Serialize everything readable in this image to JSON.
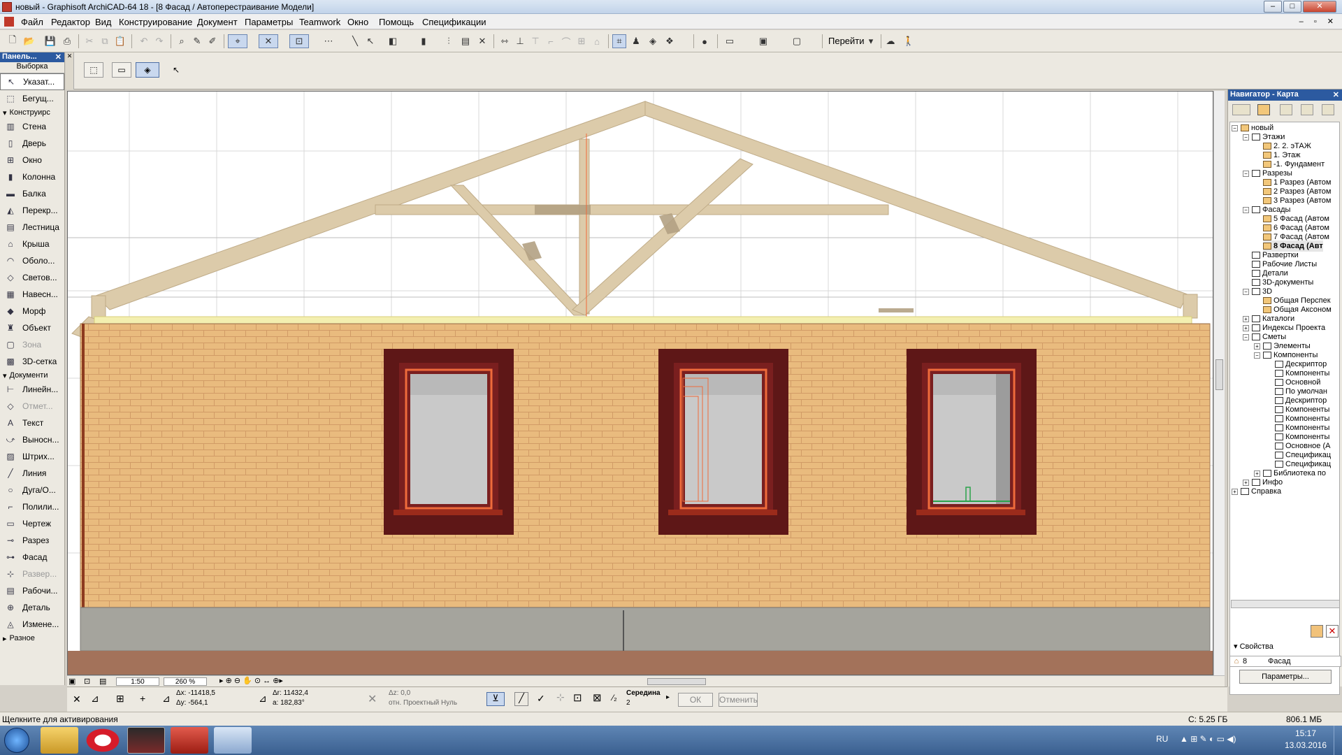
{
  "window": {
    "title": "новый - Graphisoft ArchiCAD-64 18 - [8 Фасад / Автоперестраивание Модели]"
  },
  "menu": [
    "Файл",
    "Редактор",
    "Вид",
    "Конструирование",
    "Документ",
    "Параметры",
    "Teamwork",
    "Окно",
    "Помощь",
    "Спецификации"
  ],
  "toolbar": {
    "goto_label": "Перейти"
  },
  "toolbox": {
    "title": "Панель...",
    "selection_label": "Выборка",
    "pointer": "Указат...",
    "marquee": "Бегущ...",
    "group_construct": "Конструирс",
    "construct_tools": [
      "Стена",
      "Дверь",
      "Окно",
      "Колонна",
      "Балка",
      "Перекр...",
      "Лестница",
      "Крыша",
      "Оболо...",
      "Светов...",
      "Навесн...",
      "Морф",
      "Объект",
      "Зона",
      "3D-сетка"
    ],
    "group_document": "Документи",
    "document_tools": [
      "Линейн...",
      "Отмет...",
      "Текст",
      "Выносн...",
      "Штрих...",
      "Линия",
      "Дуга/О...",
      "Полили...",
      "Чертеж",
      "Разрез",
      "Фасад",
      "Развер...",
      "Рабочи...",
      "Деталь",
      "Измене..."
    ],
    "group_misc": "Разное"
  },
  "navigator": {
    "title": "Навигатор - Карта",
    "tree": [
      {
        "label": "новый",
        "level": 0
      },
      {
        "label": "Этажи",
        "level": 1
      },
      {
        "label": "2. 2. эТАЖ",
        "level": 2
      },
      {
        "label": "1. Этаж",
        "level": 2
      },
      {
        "label": "-1. Фундамент",
        "level": 2
      },
      {
        "label": "Разрезы",
        "level": 1
      },
      {
        "label": "1 Разрез (Автом",
        "level": 2
      },
      {
        "label": "2 Разрез (Автом",
        "level": 2
      },
      {
        "label": "3 Разрез (Автом",
        "level": 2
      },
      {
        "label": "Фасады",
        "level": 1
      },
      {
        "label": "5 Фасад (Автом",
        "level": 2
      },
      {
        "label": "6 Фасад (Автом",
        "level": 2
      },
      {
        "label": "7 Фасад (Автом",
        "level": 2
      },
      {
        "label": "8 Фасад (Авт",
        "level": 2,
        "bold": true
      },
      {
        "label": "Развертки",
        "level": 1
      },
      {
        "label": "Рабочие Листы",
        "level": 1
      },
      {
        "label": "Детали",
        "level": 1
      },
      {
        "label": "3D-документы",
        "level": 1
      },
      {
        "label": "3D",
        "level": 1
      },
      {
        "label": "Общая Перспек",
        "level": 2
      },
      {
        "label": "Общая Аксоном",
        "level": 2
      },
      {
        "label": "Каталоги",
        "level": 1
      },
      {
        "label": "Индексы Проекта",
        "level": 1
      },
      {
        "label": "Сметы",
        "level": 1
      },
      {
        "label": "Элементы",
        "level": 2
      },
      {
        "label": "Компоненты",
        "level": 2
      },
      {
        "label": "Дескриптор",
        "level": 3
      },
      {
        "label": "Компоненты",
        "level": 3
      },
      {
        "label": "Основной",
        "level": 3
      },
      {
        "label": "По умолчан",
        "level": 3
      },
      {
        "label": "Дескриптор",
        "level": 3
      },
      {
        "label": "Компоненты",
        "level": 3
      },
      {
        "label": "Компоненты",
        "level": 3
      },
      {
        "label": "Компоненты",
        "level": 3
      },
      {
        "label": "Компоненты",
        "level": 3
      },
      {
        "label": "Основное (А",
        "level": 3
      },
      {
        "label": "Спецификац",
        "level": 3
      },
      {
        "label": "Спецификац",
        "level": 3
      },
      {
        "label": "Библиотека по",
        "level": 2
      },
      {
        "label": "Инфо",
        "level": 1
      },
      {
        "label": "Справка",
        "level": 0
      }
    ],
    "properties_label": "Свойства",
    "prop_id": "8",
    "prop_name": "Фасад",
    "params_button": "Параметры..."
  },
  "view": {
    "scale": "1:50",
    "zoom": "260 %"
  },
  "coords": {
    "dx": "Δx: -11418,5",
    "dy": "Δy: -564,1",
    "dr": "Δr: 11432,4",
    "da": "a: 182,83°",
    "dz": "Δz: 0,0",
    "ref": "отн. Проектный Нуль",
    "snap": "Середина",
    "snap_n": "2",
    "ok": "ОК",
    "cancel": "Отменить"
  },
  "status": {
    "hint": "Щелкните для активирования",
    "disk": "C: 5.25 ГБ",
    "ram": "806.1 МБ"
  },
  "taskbar": {
    "lang": "RU",
    "time": "15:17",
    "date": "13.03.2016"
  },
  "colors": {
    "brick": "#e9bb7e",
    "mortar": "#d9a26c",
    "frame": "#5e1717",
    "timber": "#dccbaa",
    "glass": "#c8c8c8",
    "foundation": "#a5a49d",
    "ground": "#a3725a",
    "accent": "#2c5aa0"
  }
}
